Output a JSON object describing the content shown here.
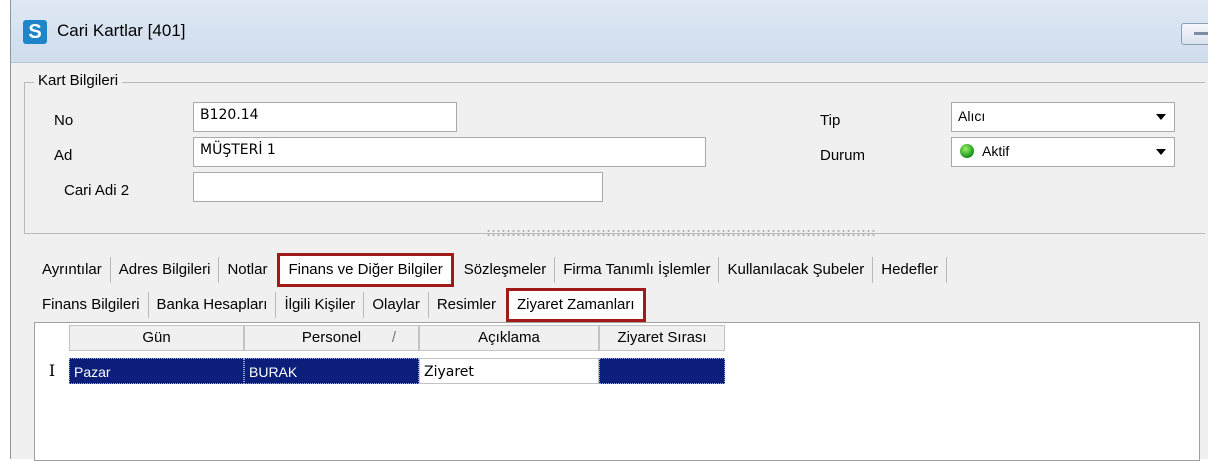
{
  "window": {
    "title": "Cari Kartlar [401]"
  },
  "kart_bilgileri": {
    "legend": "Kart Bilgileri",
    "no_label": "No",
    "no_value": "B120.14",
    "ad_label": "Ad",
    "ad_value": "MÜŞTERİ 1",
    "cari_adi2_label": "Cari Adi 2",
    "cari_adi2_value": "",
    "tip_label": "Tip",
    "tip_value": "Alıcı",
    "durum_label": "Durum",
    "durum_value": "Aktif"
  },
  "main_tabs": [
    "Ayrıntılar",
    "Adres Bilgileri",
    "Notlar",
    "Finans ve Diğer Bilgiler",
    "Sözleşmeler",
    "Firma Tanımlı İşlemler",
    "Kullanılacak Şubeler",
    "Hedefler"
  ],
  "sub_tabs": [
    "Finans Bilgileri",
    "Banka Hesapları",
    "İlgili Kişiler",
    "Olaylar",
    "Resimler",
    "Ziyaret Zamanları"
  ],
  "grid": {
    "columns": [
      "Gün",
      "Personel",
      "Açıklama",
      "Ziyaret Sırası"
    ],
    "sort_indicator": "/",
    "row_indicator": "I",
    "rows": [
      {
        "gun": "Pazar",
        "personel": "BURAK",
        "aciklama": "Ziyaret",
        "ziyaret_sirasi": ""
      }
    ]
  }
}
